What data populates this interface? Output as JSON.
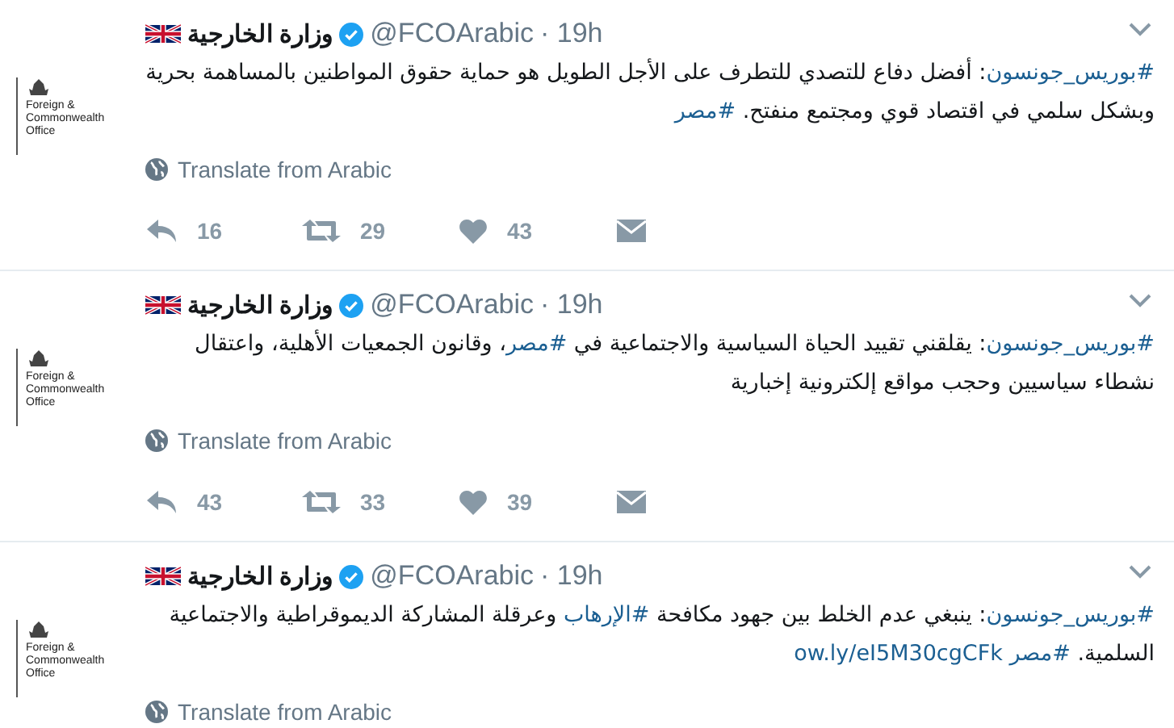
{
  "tweets": [
    {
      "avatar_text": [
        "Foreign &",
        "Commonwealth",
        "Office"
      ],
      "name": "وزارة الخارجية",
      "verified": true,
      "handle": "@FCOArabic",
      "time": "· 19h",
      "body": [
        {
          "kind": "link",
          "text": "#بوريس_جونسون"
        },
        {
          "kind": "text",
          "text": ": أفضل دفاع للتصدي للتطرف على الأجل الطويل هو حماية حقوق المواطنين بالمساهمة بحرية وبشكل سلمي في اقتصاد قوي ومجتمع منفتح. "
        },
        {
          "kind": "link",
          "text": "#مصر"
        }
      ],
      "translate": "Translate from Arabic",
      "actions": {
        "replies": "16",
        "retweets": "29",
        "likes": "43"
      }
    },
    {
      "avatar_text": [
        "Foreign &",
        "Commonwealth",
        "Office"
      ],
      "name": "وزارة الخارجية",
      "verified": true,
      "handle": "@FCOArabic",
      "time": "· 19h",
      "body": [
        {
          "kind": "link",
          "text": "#بوريس_جونسون"
        },
        {
          "kind": "text",
          "text": ": يقلقني تقييد الحياة السياسية والاجتماعية في "
        },
        {
          "kind": "link",
          "text": "#مصر"
        },
        {
          "kind": "text",
          "text": "، وقانون الجمعيات الأهلية، واعتقال نشطاء سياسيين وحجب مواقع إلكترونية إخبارية"
        }
      ],
      "translate": "Translate from Arabic",
      "actions": {
        "replies": "43",
        "retweets": "33",
        "likes": "39"
      }
    },
    {
      "avatar_text": [
        "Foreign &",
        "Commonwealth",
        "Office"
      ],
      "name": "وزارة الخارجية",
      "verified": true,
      "handle": "@FCOArabic",
      "time": "· 19h",
      "body": [
        {
          "kind": "link",
          "text": "#بوريس_جونسون"
        },
        {
          "kind": "text",
          "text": ": ينبغي عدم الخلط بين جهود مكافحة "
        },
        {
          "kind": "link",
          "text": "#الإرهاب"
        },
        {
          "kind": "text",
          "text": " وعرقلة المشاركة الديموقراطية والاجتماعية السلمية. "
        },
        {
          "kind": "link",
          "text": "#مصر"
        },
        {
          "kind": "link",
          "text": "ow.ly/eI5M30cgCFk"
        }
      ],
      "translate": "Translate from Arabic"
    }
  ]
}
